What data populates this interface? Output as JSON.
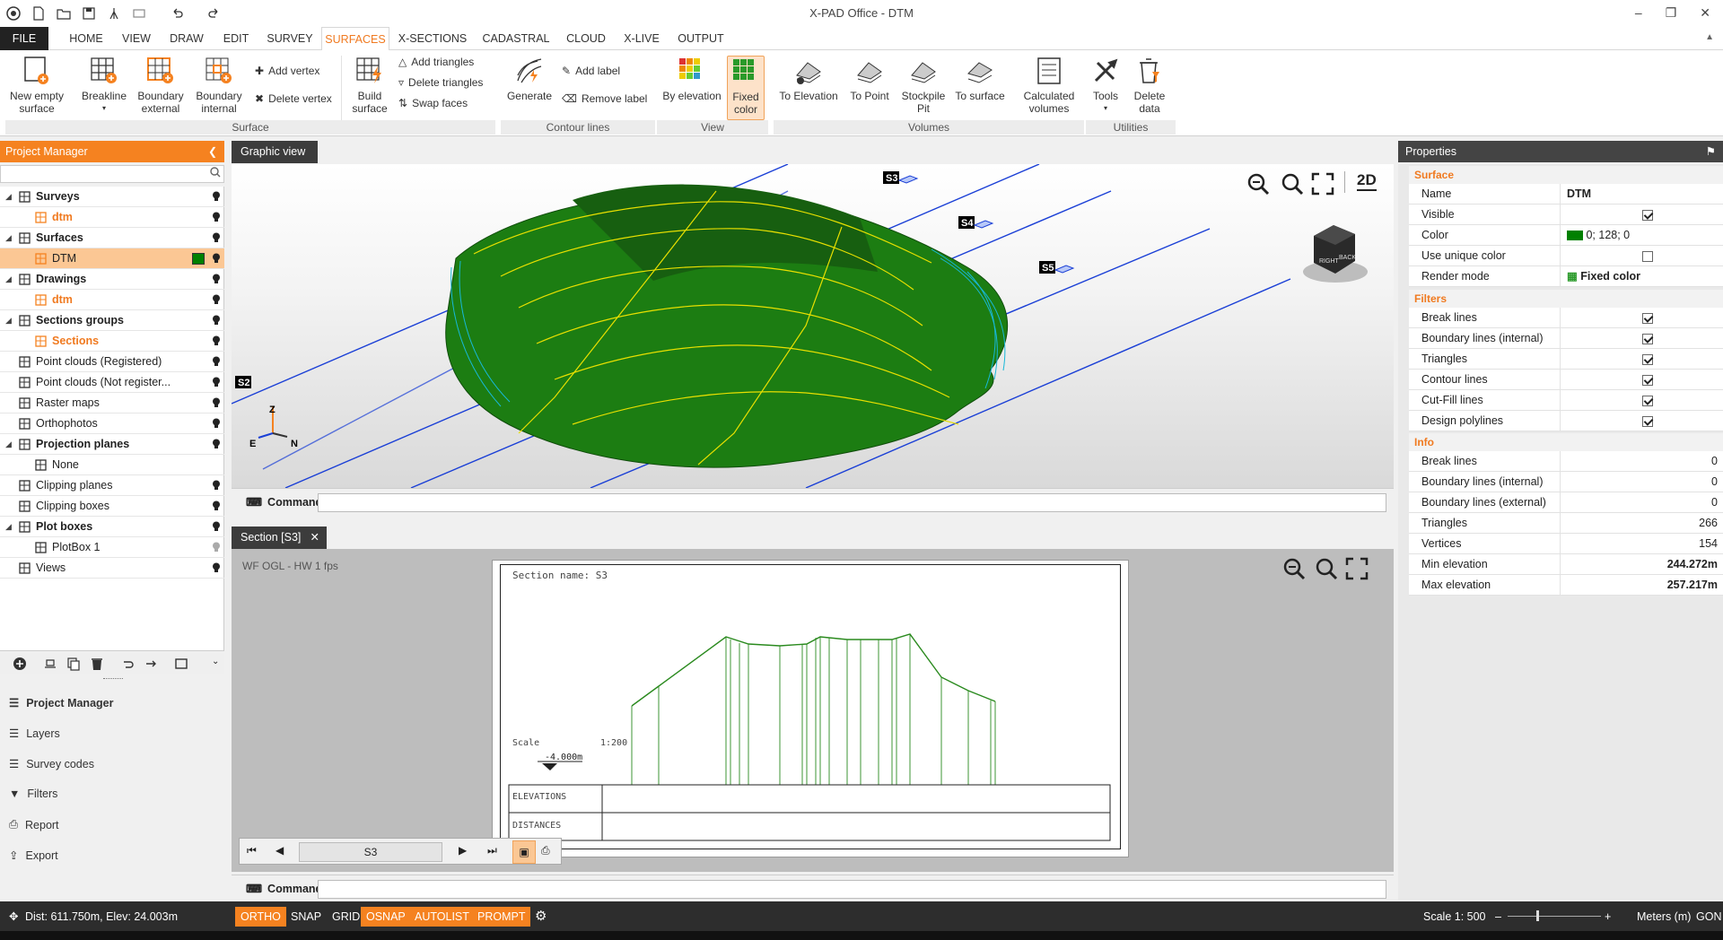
{
  "app": {
    "title": "X-PAD Office - DTM"
  },
  "menu": {
    "tabs": [
      "FILE",
      "HOME",
      "VIEW",
      "DRAW",
      "EDIT",
      "SURVEY",
      "SURFACES",
      "X-SECTIONS",
      "CADASTRAL",
      "CLOUD",
      "X-LIVE",
      "OUTPUT"
    ],
    "active": "SURFACES"
  },
  "ribbon": {
    "surface": {
      "new_empty": "New empty surface",
      "breakline": "Breakline",
      "boundary_external": "Boundary external",
      "boundary_internal": "Boundary internal",
      "add_vertex": "Add vertex",
      "delete_vertex": "Delete vertex",
      "build_surface": "Build surface",
      "add_triangles": "Add triangles",
      "delete_triangles": "Delete triangles",
      "swap_faces": "Swap faces"
    },
    "contour": {
      "generate": "Generate",
      "add_label": "Add label",
      "remove_label": "Remove label"
    },
    "view": {
      "by_elevation": "By elevation",
      "fixed_color": "Fixed color"
    },
    "volumes": {
      "to_elevation": "To Elevation",
      "to_point": "To Point",
      "stockpile_pit": "Stockpile Pit",
      "to_surface": "To surface",
      "calculated_volumes": "Calculated volumes"
    },
    "utilities": {
      "tools": "Tools",
      "delete_data": "Delete data"
    },
    "groups": {
      "surface": "Surface",
      "contour_lines": "Contour lines",
      "view": "View",
      "volumes": "Volumes",
      "utilities": "Utilities"
    }
  },
  "project_manager": {
    "title": "Project Manager",
    "search_placeholder": "",
    "tree": [
      {
        "label": "Surveys",
        "bold": true
      },
      {
        "label": "dtm",
        "orange": true
      },
      {
        "label": "Surfaces",
        "bold": true
      },
      {
        "label": "DTM",
        "selected": true
      },
      {
        "label": "Drawings",
        "bold": true
      },
      {
        "label": "dtm",
        "orange": true
      },
      {
        "label": "Sections groups",
        "bold": true
      },
      {
        "label": "Sections",
        "orange": true
      },
      {
        "label": "Point clouds (Registered)"
      },
      {
        "label": "Point clouds (Not register..."
      },
      {
        "label": "Raster maps"
      },
      {
        "label": "Orthophotos"
      },
      {
        "label": "Projection planes",
        "bold": true
      },
      {
        "label": "None"
      },
      {
        "label": "Clipping planes"
      },
      {
        "label": "Clipping boxes"
      },
      {
        "label": "Plot boxes",
        "bold": true
      },
      {
        "label": "PlotBox 1"
      },
      {
        "label": "Views"
      }
    ],
    "nav": [
      "Project Manager",
      "Layers",
      "Survey codes",
      "Filters",
      "Report",
      "Export"
    ]
  },
  "graphic_view": {
    "tab": "Graphic view",
    "view_mode": "2D",
    "section_labels": [
      "S2",
      "S3",
      "S4",
      "S5"
    ],
    "axes": {
      "z": "Z",
      "e": "E",
      "n": "N"
    },
    "cube_labels": [
      "RIGHT",
      "BACK"
    ]
  },
  "command": {
    "label": "Command",
    "value": ""
  },
  "section_view": {
    "tab": "Section [S3]",
    "info": "WF OGL - HW  1 fps",
    "sheet": {
      "name": "Section name: S3",
      "scale_label": "Scale",
      "scale_value": "1:200",
      "ref_level": "-4.000m",
      "row_elevations": "ELEVATIONS",
      "row_distances": "DISTANCES"
    },
    "nav_current": "S3"
  },
  "properties": {
    "title": "Properties",
    "sections": {
      "surface": "Surface",
      "filters": "Filters",
      "info": "Info"
    },
    "surface": {
      "name_k": "Name",
      "name": "DTM",
      "visible_k": "Visible",
      "visible": true,
      "color_k": "Color",
      "color": "0; 128; 0",
      "color_hex": "#008000",
      "unique_k": "Use unique color",
      "unique": false,
      "render_k": "Render mode",
      "render": "Fixed color"
    },
    "filters": [
      {
        "k": "Break lines",
        "v": true
      },
      {
        "k": "Boundary lines (internal)",
        "v": true
      },
      {
        "k": "Triangles",
        "v": true
      },
      {
        "k": "Contour lines",
        "v": true
      },
      {
        "k": "Cut-Fill lines",
        "v": true
      },
      {
        "k": "Design polylines",
        "v": true
      }
    ],
    "info": [
      {
        "k": "Break lines",
        "v": "0"
      },
      {
        "k": "Boundary lines (internal)",
        "v": "0"
      },
      {
        "k": "Boundary lines (external)",
        "v": "0"
      },
      {
        "k": "Triangles",
        "v": "266"
      },
      {
        "k": "Vertices",
        "v": "154"
      },
      {
        "k": "Min elevation",
        "v": "244.272m"
      },
      {
        "k": "Max elevation",
        "v": "257.217m"
      }
    ]
  },
  "status": {
    "coords": "Dist: 611.750m, Elev: 24.003m",
    "toggles": [
      {
        "label": "ORTHO",
        "on": true
      },
      {
        "label": "SNAP",
        "on": false
      },
      {
        "label": "GRID",
        "on": false
      },
      {
        "label": "OSNAP",
        "on": true
      },
      {
        "label": "AUTOLIST",
        "on": true
      },
      {
        "label": "PROMPT",
        "on": true
      }
    ],
    "scale": "Scale 1: 500",
    "units": "Meters (m)",
    "angle": "GON"
  },
  "colors": {
    "accent": "#f58220",
    "surface_green": "#1e8a14",
    "contour_yellow": "#e8e000",
    "contour_cyan": "#18b8d8",
    "section_line": "#1a3fd6"
  }
}
